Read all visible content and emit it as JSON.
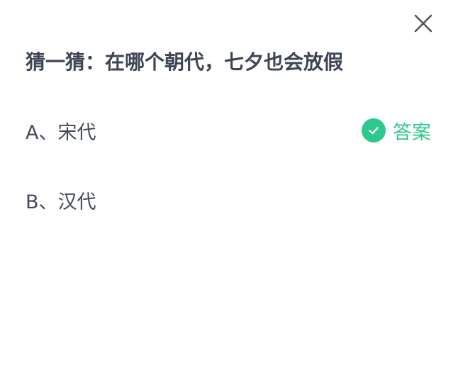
{
  "quiz": {
    "question": "猜一猜：在哪个朝代，七夕也会放假",
    "options": [
      {
        "label": "A、宋代",
        "is_answer": true
      },
      {
        "label": "B、汉代",
        "is_answer": false
      }
    ],
    "answer_badge_label": "答案"
  },
  "icons": {
    "close": "close-icon",
    "check": "check-circle-icon"
  },
  "colors": {
    "accent": "#2cc98b",
    "question_text": "#3d4454",
    "option_text": "#444a57",
    "close_icon": "#555555"
  }
}
